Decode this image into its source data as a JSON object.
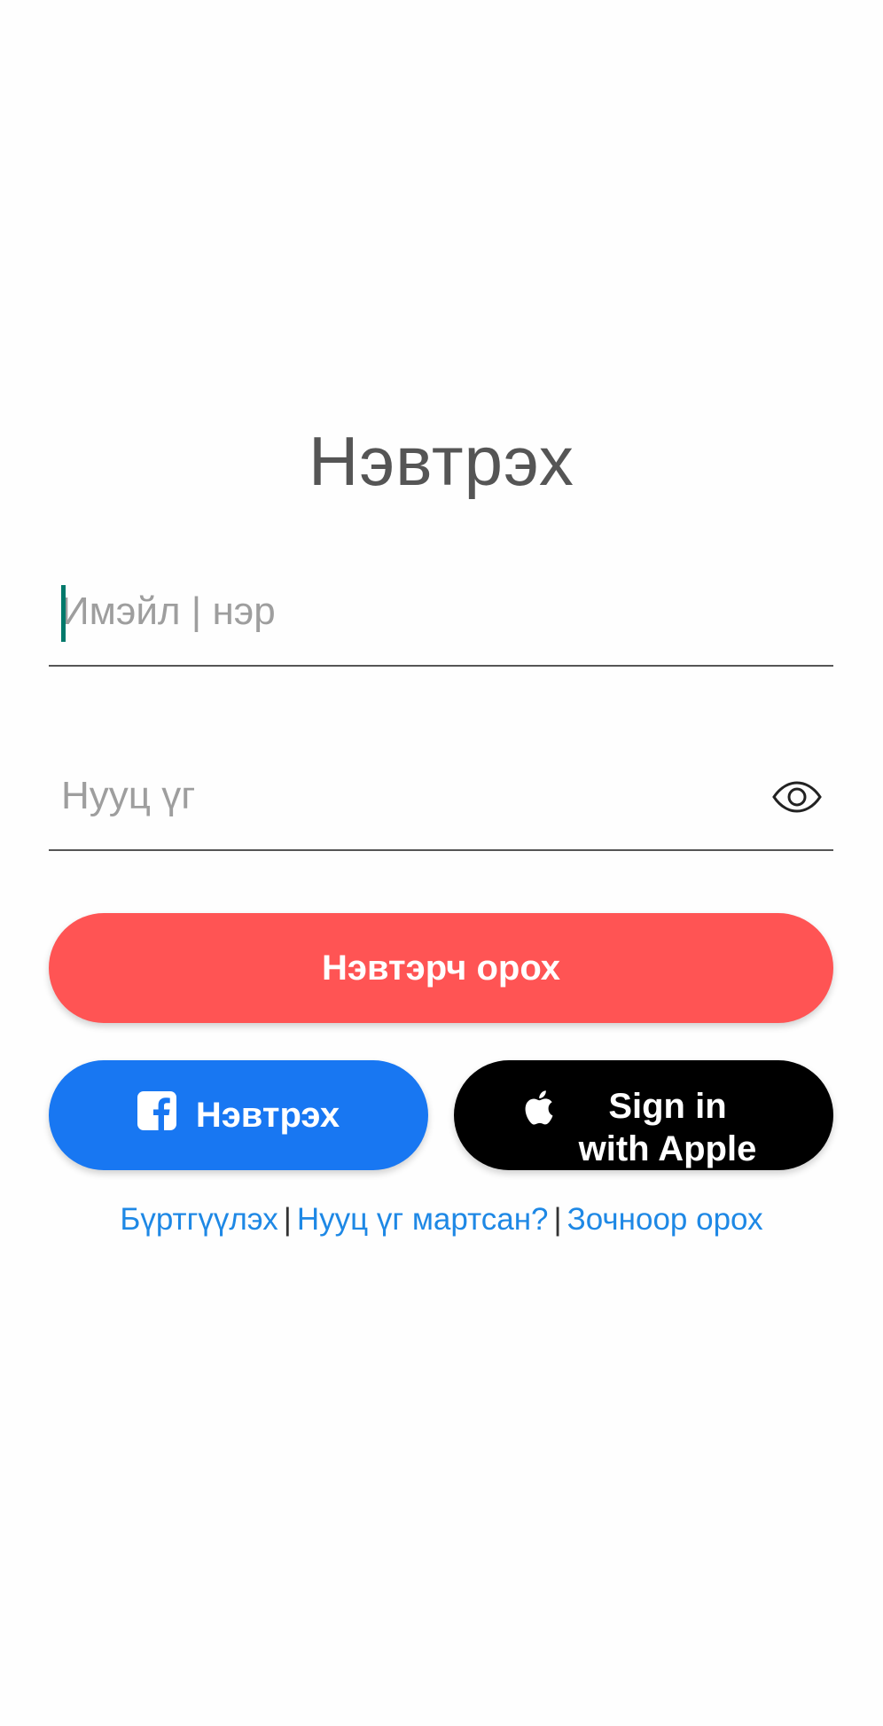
{
  "login": {
    "title": "Нэвтрэх",
    "email_placeholder": "Имэйл | нэр",
    "password_placeholder": "Нууц үг",
    "login_button_label": "Нэвтэрч орох",
    "facebook_button_label": "Нэвтрэх",
    "apple_button_label": "Sign in with Apple",
    "links": {
      "register": "Бүртгүүлэх",
      "forgot_password": "Нууц үг мартсан?",
      "guest": "Зочноор орох",
      "separator": "|"
    }
  },
  "icons": {
    "facebook": "facebook-icon",
    "apple": "apple-icon",
    "show_password": "eye-icon"
  },
  "colors": {
    "login_button": "#ff5454",
    "facebook_button": "#1877f2",
    "apple_button": "#000000",
    "link": "#1e88e5",
    "caret": "#00796b"
  }
}
